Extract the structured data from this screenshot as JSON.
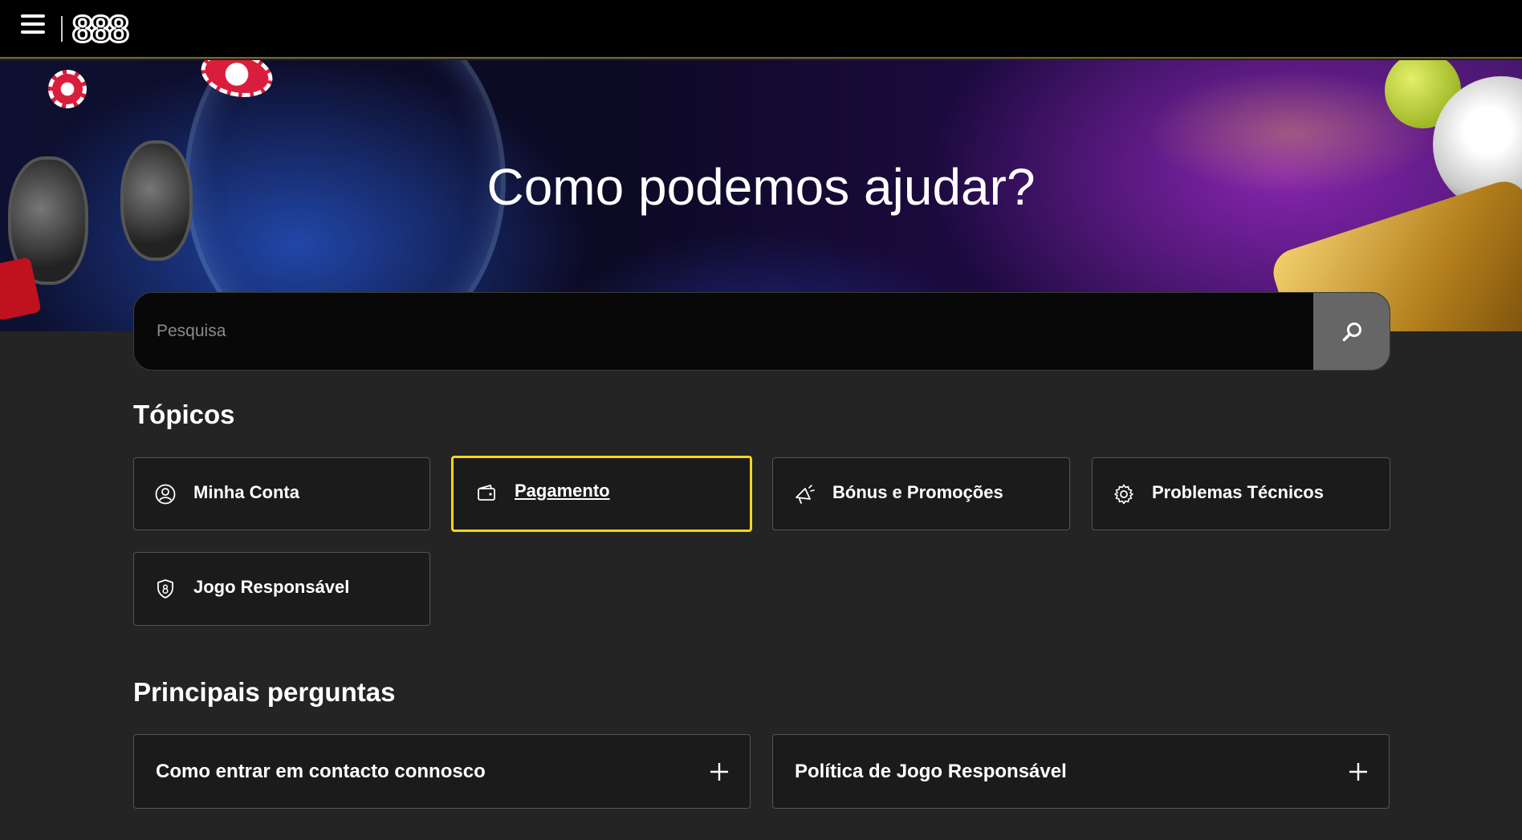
{
  "header": {
    "menu_icon": "hamburger-menu-icon",
    "logo_text": "888"
  },
  "hero": {
    "title": "Como podemos ajudar?"
  },
  "search": {
    "placeholder": "Pesquisa",
    "value": "",
    "button_icon": "search-icon"
  },
  "topics": {
    "title": "Tópicos",
    "items": [
      {
        "label": "Minha Conta",
        "icon": "user-icon",
        "active": false
      },
      {
        "label": "Pagamento",
        "icon": "wallet-icon",
        "active": true
      },
      {
        "label": "Bónus e Promoções",
        "icon": "megaphone-icon",
        "active": false
      },
      {
        "label": "Problemas Técnicos",
        "icon": "gear-icon",
        "active": false
      },
      {
        "label": "Jogo Responsável",
        "icon": "shield-8-icon",
        "active": false
      }
    ]
  },
  "faqs": {
    "title": "Principais perguntas",
    "items": [
      {
        "label": "Como entrar em contacto connosco",
        "icon": "plus-icon"
      },
      {
        "label": "Política de Jogo Responsável",
        "icon": "plus-icon"
      }
    ]
  },
  "colors": {
    "background": "#242424",
    "topbar": "#000000",
    "accent": "#f7d51d",
    "card": "#1b1b1b",
    "card_border": "#545454",
    "search_button": "#666666"
  }
}
